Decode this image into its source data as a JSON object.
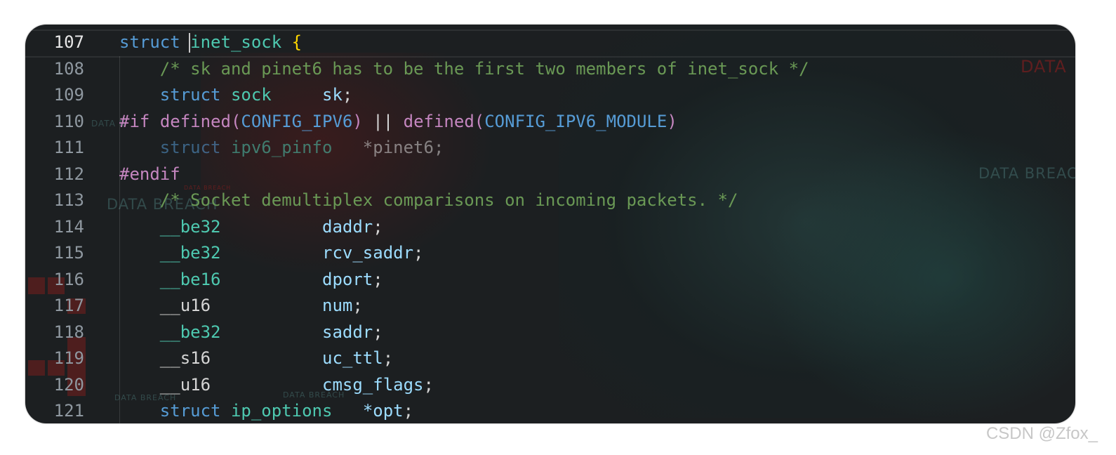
{
  "editor": {
    "active_line": "107",
    "lines": [
      {
        "num": "107",
        "tokens": [
          {
            "t": "struct",
            "c": "kw"
          },
          {
            "t": " ",
            "c": "pun"
          },
          {
            "t": "inet_sock",
            "c": "type"
          },
          {
            "t": " ",
            "c": "pun"
          },
          {
            "t": "{",
            "c": "brace"
          }
        ]
      },
      {
        "num": "108",
        "tokens": [
          {
            "t": "    /* sk and pinet6 has to be the first two members of inet_sock */",
            "c": "cmt"
          }
        ]
      },
      {
        "num": "109",
        "tokens": [
          {
            "t": "    struct",
            "c": "kw"
          },
          {
            "t": " sock",
            "c": "type"
          },
          {
            "t": "     ",
            "c": "pun"
          },
          {
            "t": "sk",
            "c": "var"
          },
          {
            "t": ";",
            "c": "pun"
          }
        ]
      },
      {
        "num": "110",
        "tokens": [
          {
            "t": "#if",
            "c": "pp"
          },
          {
            "t": " ",
            "c": "pun"
          },
          {
            "t": "defined",
            "c": "pp"
          },
          {
            "t": "(",
            "c": "pp"
          },
          {
            "t": "CONFIG_IPV6",
            "c": "mac"
          },
          {
            "t": ")",
            "c": "pp"
          },
          {
            "t": " || ",
            "c": "pun"
          },
          {
            "t": "defined",
            "c": "pp"
          },
          {
            "t": "(",
            "c": "pp"
          },
          {
            "t": "CONFIG_IPV6_MODULE",
            "c": "mac"
          },
          {
            "t": ")",
            "c": "pp"
          }
        ]
      },
      {
        "num": "111",
        "tokens": [
          {
            "t": "    struct",
            "c": "kw dim"
          },
          {
            "t": " ipv6_pinfo",
            "c": "type dim"
          },
          {
            "t": "   *pinet6;",
            "c": "pun dim"
          }
        ]
      },
      {
        "num": "112",
        "tokens": [
          {
            "t": "#endif",
            "c": "pp"
          }
        ]
      },
      {
        "num": "113",
        "tokens": [
          {
            "t": "    /* Socket demultiplex comparisons on incoming packets. */",
            "c": "cmt"
          }
        ]
      },
      {
        "num": "114",
        "tokens": [
          {
            "t": "    __be32",
            "c": "type"
          },
          {
            "t": "          ",
            "c": "pun"
          },
          {
            "t": "daddr",
            "c": "var"
          },
          {
            "t": ";",
            "c": "pun"
          }
        ]
      },
      {
        "num": "115",
        "tokens": [
          {
            "t": "    __be32",
            "c": "type"
          },
          {
            "t": "          ",
            "c": "pun"
          },
          {
            "t": "rcv_saddr",
            "c": "var"
          },
          {
            "t": ";",
            "c": "pun"
          }
        ]
      },
      {
        "num": "116",
        "tokens": [
          {
            "t": "    __be16",
            "c": "type"
          },
          {
            "t": "          ",
            "c": "pun"
          },
          {
            "t": "dport",
            "c": "var"
          },
          {
            "t": ";",
            "c": "pun"
          }
        ]
      },
      {
        "num": "117",
        "tokens": [
          {
            "t": "    __u16",
            "c": "pun"
          },
          {
            "t": "           ",
            "c": "pun"
          },
          {
            "t": "num",
            "c": "var"
          },
          {
            "t": ";",
            "c": "pun"
          }
        ]
      },
      {
        "num": "118",
        "tokens": [
          {
            "t": "    __be32",
            "c": "type"
          },
          {
            "t": "          ",
            "c": "pun"
          },
          {
            "t": "saddr",
            "c": "var"
          },
          {
            "t": ";",
            "c": "pun"
          }
        ]
      },
      {
        "num": "119",
        "tokens": [
          {
            "t": "    __s16",
            "c": "pun"
          },
          {
            "t": "           ",
            "c": "pun"
          },
          {
            "t": "uc_ttl",
            "c": "var"
          },
          {
            "t": ";",
            "c": "pun"
          }
        ]
      },
      {
        "num": "120",
        "tokens": [
          {
            "t": "    __u16",
            "c": "pun"
          },
          {
            "t": "           ",
            "c": "pun"
          },
          {
            "t": "cmsg_flags",
            "c": "var"
          },
          {
            "t": ";",
            "c": "pun"
          }
        ]
      },
      {
        "num": "121",
        "tokens": [
          {
            "t": "    struct",
            "c": "kw"
          },
          {
            "t": " ip_options",
            "c": "type"
          },
          {
            "t": "   ",
            "c": "pun"
          },
          {
            "t": "*opt",
            "c": "var"
          },
          {
            "t": ";",
            "c": "pun"
          }
        ]
      }
    ]
  },
  "background": {
    "labels": [
      "DATA B",
      "DATA BREAC",
      "DATA BREACH",
      "DATA",
      "DATA BREACH",
      "DATA BREACH",
      "DATA BREACH"
    ]
  },
  "watermark": "CSDN @Zfox_",
  "colors": {
    "keyword": "#569cd6",
    "type": "#4ec9b0",
    "variable": "#9cdcfe",
    "comment": "#6a9955",
    "preprocessor": "#c586c0",
    "brace": "#ffd700"
  }
}
